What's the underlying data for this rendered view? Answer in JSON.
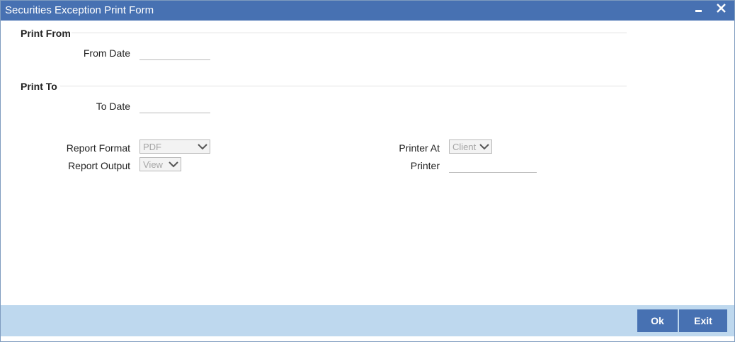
{
  "window": {
    "title": "Securities Exception Print Form"
  },
  "print_from": {
    "section_title": "Print From",
    "from_date_label": "From Date",
    "from_date_value": ""
  },
  "print_to": {
    "section_title": "Print To",
    "to_date_label": "To Date",
    "to_date_value": ""
  },
  "report": {
    "format_label": "Report Format",
    "format_value": "PDF",
    "output_label": "Report Output",
    "output_value": "View",
    "printer_at_label": "Printer At",
    "printer_at_value": "Client",
    "printer_label": "Printer",
    "printer_value": ""
  },
  "footer": {
    "ok_label": "Ok",
    "exit_label": "Exit"
  },
  "icons": {
    "minimize": "minimize-icon",
    "close": "close-icon",
    "dropdown": "chevron-down-icon"
  },
  "colors": {
    "titlebar": "#4771b2",
    "footer": "#bed8ee",
    "button": "#4771b2"
  }
}
